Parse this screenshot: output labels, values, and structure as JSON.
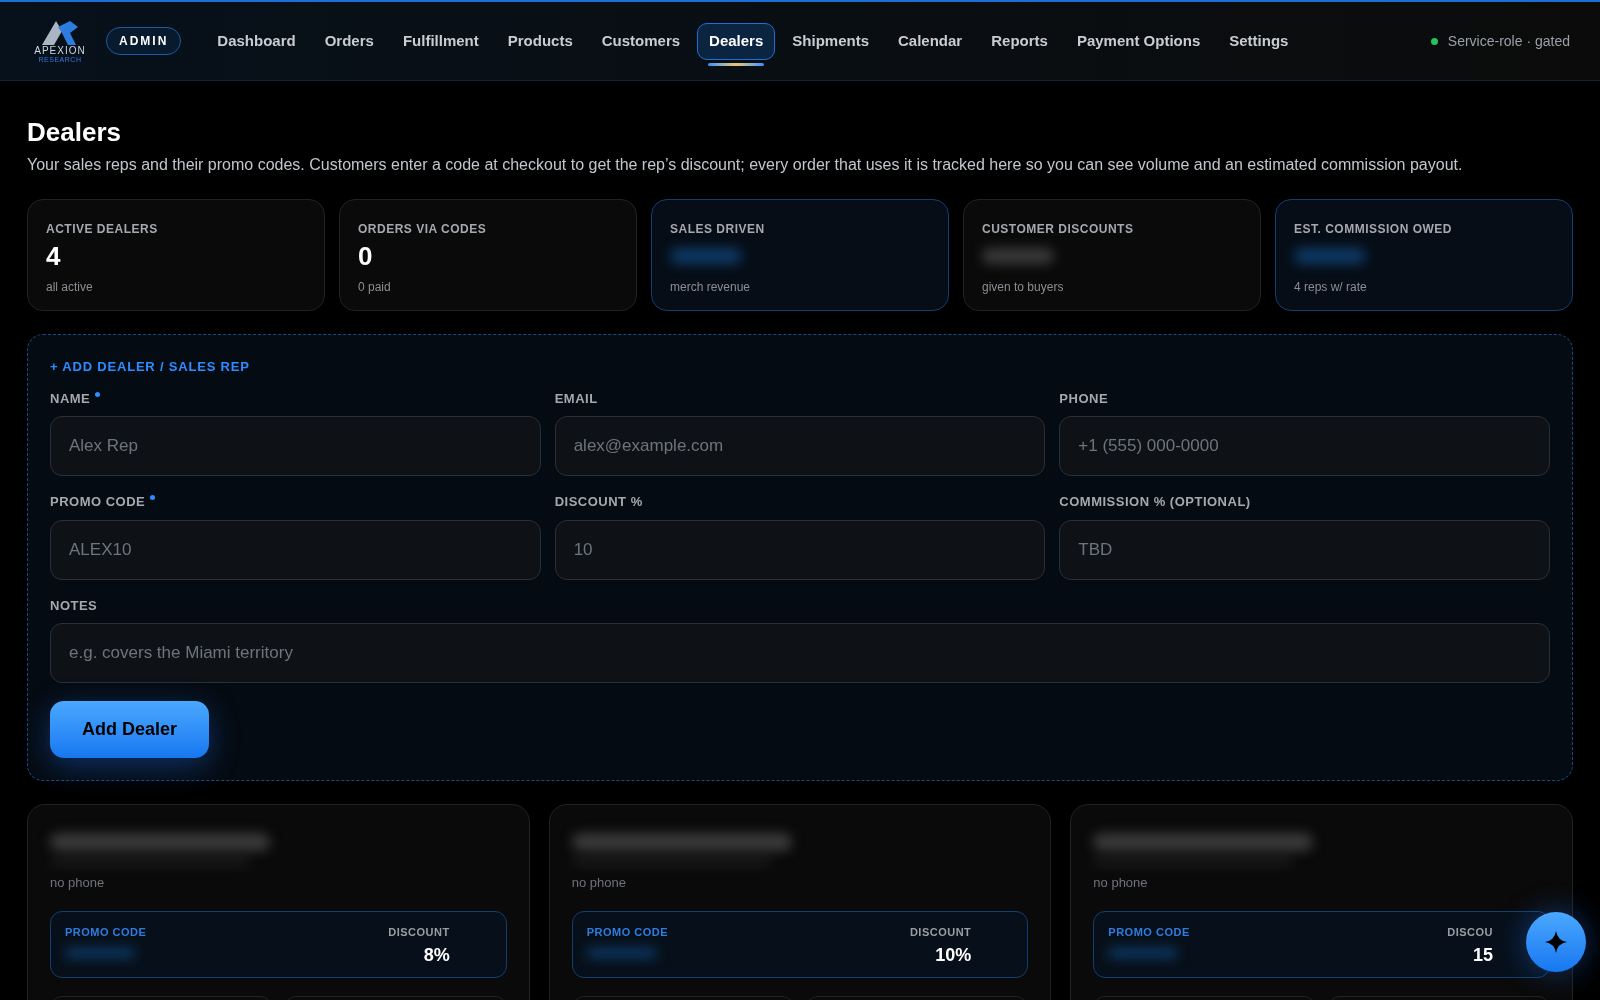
{
  "nav": {
    "logo": {
      "name": "APEXION",
      "tagline": "RESEARCH"
    },
    "badge": "ADMIN",
    "tabs": [
      {
        "label": "Dashboard",
        "selected": false
      },
      {
        "label": "Orders",
        "selected": false
      },
      {
        "label": "Fulfillment",
        "selected": false
      },
      {
        "label": "Products",
        "selected": false
      },
      {
        "label": "Customers",
        "selected": false
      },
      {
        "label": "Dealers",
        "selected": true
      },
      {
        "label": "Shipments",
        "selected": false
      },
      {
        "label": "Calendar",
        "selected": false
      },
      {
        "label": "Reports",
        "selected": false
      },
      {
        "label": "Payment Options",
        "selected": false
      },
      {
        "label": "Settings",
        "selected": false
      }
    ],
    "status": {
      "label": "Service-role · gated",
      "on": true
    }
  },
  "page": {
    "title": "Dealers",
    "description": "Your sales reps and their promo codes. Customers enter a code at checkout to get the rep’s discount; every order that uses it is tracked here so you can see volume and an estimated commission payout."
  },
  "stats": [
    {
      "label": "ACTIVE DEALERS",
      "kind": "number",
      "value": "4",
      "note": "all active",
      "highlighted": false
    },
    {
      "label": "ORDERS VIA CODES",
      "kind": "number",
      "value": "0",
      "note": "0 paid",
      "highlighted": false
    },
    {
      "label": "SALES DRIVEN",
      "kind": "redacted",
      "note": "merch revenue",
      "highlighted": true
    },
    {
      "label": "CUSTOMER DISCOUNTS",
      "kind": "redacted",
      "note": "given to buyers",
      "highlighted": false
    },
    {
      "label": "EST. COMMISSION OWED",
      "kind": "redacted",
      "note": "4 reps w/ rate",
      "highlighted": true
    }
  ],
  "form": {
    "title": "+ ADD DEALER / SALES REP",
    "fields": [
      {
        "label": "NAME",
        "required": true,
        "placeholder": "Alex Rep"
      },
      {
        "label": "EMAIL",
        "required": false,
        "placeholder": "alex@example.com"
      },
      {
        "label": "PHONE",
        "required": false,
        "placeholder": "+1 (555) 000-0000"
      },
      {
        "label": "PROMO CODE",
        "required": true,
        "placeholder": "ALEX10"
      },
      {
        "label": "DISCOUNT %",
        "required": false,
        "placeholder": "10"
      },
      {
        "label": "COMMISSION % (OPTIONAL)",
        "required": false,
        "placeholder": "TBD"
      }
    ],
    "notes": {
      "label": "NOTES",
      "placeholder": "e.g. covers the Miami territory"
    },
    "button": "Add Dealer"
  },
  "dealers": [
    {
      "phone": "no phone",
      "promo_label": "PROMO CODE",
      "discount_label": "DISCOUNT",
      "discount": "8%"
    },
    {
      "phone": "no phone",
      "promo_label": "PROMO CODE",
      "discount_label": "DISCOUNT",
      "discount": "10%"
    },
    {
      "phone": "no phone",
      "promo_label": "PROMO CODE",
      "discount_label": "DISCOU",
      "discount": "15"
    }
  ]
}
